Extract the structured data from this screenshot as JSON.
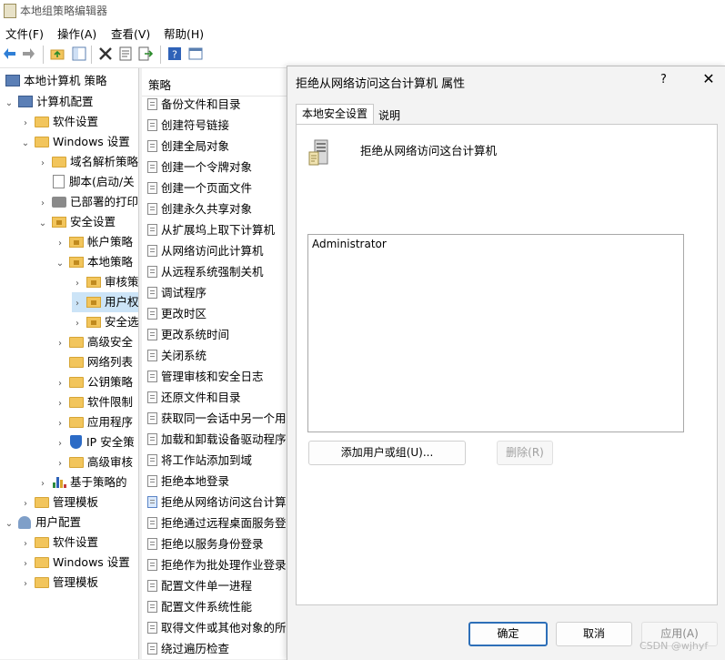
{
  "window": {
    "title": "本地组策略编辑器"
  },
  "menu": [
    "文件(F)",
    "操作(A)",
    "查看(V)",
    "帮助(H)"
  ],
  "toolbar_icons": [
    "back-arrow-icon",
    "forward-arrow-icon",
    "up-folder-icon",
    "show-tree-icon",
    "delete-icon",
    "properties-icon",
    "export-list-icon",
    "help-icon",
    "console-icon"
  ],
  "tree": {
    "items": [
      {
        "label": "本地计算机 策略",
        "icon": "computer-icon",
        "expanded": true
      },
      {
        "label": "计算机配置",
        "icon": "computer-icon",
        "expanded": true
      },
      {
        "label": "软件设置",
        "icon": "folder-icon"
      },
      {
        "label": "Windows 设置",
        "icon": "folder-icon",
        "expanded": true
      },
      {
        "label": "域名解析策略",
        "icon": "folder-icon"
      },
      {
        "label": "脚本(启动/关",
        "icon": "script-icon"
      },
      {
        "label": "已部署的打印",
        "icon": "printer-icon"
      },
      {
        "label": "安全设置",
        "icon": "lock-folder-icon",
        "expanded": true
      },
      {
        "label": "帐户策略",
        "icon": "lock-folder-icon"
      },
      {
        "label": "本地策略",
        "icon": "lock-folder-icon",
        "expanded": true
      },
      {
        "label": "审核策",
        "icon": "lock-folder-icon"
      },
      {
        "label": "用户权",
        "icon": "lock-folder-icon",
        "selected": true
      },
      {
        "label": "安全选",
        "icon": "lock-folder-icon"
      },
      {
        "label": "高级安全",
        "icon": "folder-icon"
      },
      {
        "label": "网络列表",
        "icon": "folder-icon"
      },
      {
        "label": "公钥策略",
        "icon": "folder-icon"
      },
      {
        "label": "软件限制",
        "icon": "folder-icon"
      },
      {
        "label": "应用程序",
        "icon": "folder-icon"
      },
      {
        "label": "IP 安全策",
        "icon": "shield-icon"
      },
      {
        "label": "高级审核",
        "icon": "folder-icon"
      },
      {
        "label": "基于策略的",
        "icon": "chart-icon"
      },
      {
        "label": "管理模板",
        "icon": "folder-icon"
      },
      {
        "label": "用户配置",
        "icon": "user-icon",
        "expanded": true
      },
      {
        "label": "软件设置",
        "icon": "folder-icon"
      },
      {
        "label": "Windows 设置",
        "icon": "folder-icon"
      },
      {
        "label": "管理模板",
        "icon": "folder-icon"
      }
    ]
  },
  "list": {
    "header": "策略",
    "items": [
      "备份文件和目录",
      "创建符号链接",
      "创建全局对象",
      "创建一个令牌对象",
      "创建一个页面文件",
      "创建永久共享对象",
      "从扩展坞上取下计算机",
      "从网络访问此计算机",
      "从远程系统强制关机",
      "调试程序",
      "更改时区",
      "更改系统时间",
      "关闭系统",
      "管理审核和安全日志",
      "还原文件和目录",
      "获取同一会话中另一个用",
      "加载和卸载设备驱动程序",
      "将工作站添加到域",
      "拒绝本地登录",
      "拒绝从网络访问这台计算",
      "拒绝通过远程桌面服务登",
      "拒绝以服务身份登录",
      "拒绝作为批处理作业登录",
      "配置文件单一进程",
      "配置文件系统性能",
      "取得文件或其他对象的所",
      "绕过遍历检查"
    ],
    "highlighted_index": 19
  },
  "dialog": {
    "title": "拒绝从网络访问这台计算机 属性",
    "help": "?",
    "close": "✕",
    "tabs": [
      "本地安全设置",
      "说明"
    ],
    "policy_name": "拒绝从网络访问这台计算机",
    "users": [
      "Administrator"
    ],
    "add_button": "添加用户或组(U)...",
    "remove_button": "删除(R)",
    "ok_button": "确定",
    "cancel_button": "取消",
    "apply_button": "应用(A)"
  },
  "watermark": "CSDN @wjhyf"
}
